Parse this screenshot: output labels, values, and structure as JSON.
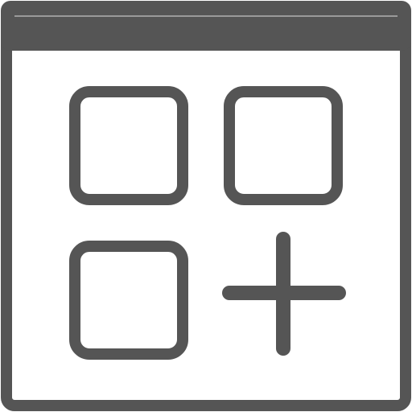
{
  "icon": {
    "name": "add-app-grid-icon",
    "colors": {
      "stroke": "#555555",
      "titlebar": "#555555",
      "titlebar_highlight": "#9a9a9a",
      "background": "#ffffff"
    }
  }
}
